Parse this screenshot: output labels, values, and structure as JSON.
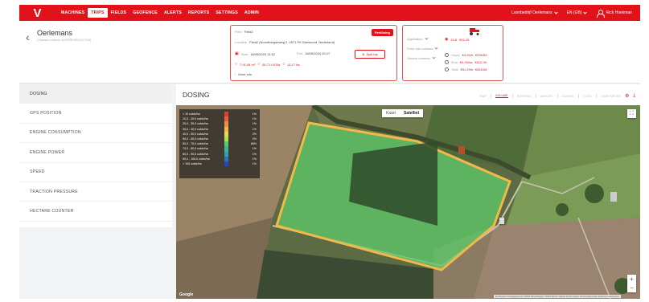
{
  "nav": {
    "logo": "V",
    "items": [
      "MACHINES",
      "TRIPS",
      "FIELDS",
      "GEOFENCE",
      "ALERTS",
      "REPORTS",
      "SETTINGS",
      "ADMIN"
    ],
    "active": "TRIPS",
    "company": "Loonbedrijf Oerlemans",
    "language": "EN (GB)",
    "user": "Rick Hoekman"
  },
  "trip": {
    "title": "Oerlemans",
    "subtitle": "Chassis number: AGFRE0003747105"
  },
  "info_card": {
    "field_label": "Field",
    "field_value": "Field2",
    "status_badge": "Fertilising",
    "location_label": "Location",
    "location_value": "Field2 (Noordbergseweg 2, 4571 PK Driewoord, Nederland)",
    "start_label": "Start",
    "start_value": "18/09/2024 11:12",
    "end_label": "End",
    "end_value": "18/09/2024 20:17",
    "split_button": "Split trip",
    "metric1": "7,91,08 m³",
    "metric2": "60,71 l/100a",
    "metric3": "11,17 ha",
    "more_info": "More info"
  },
  "cost_card": {
    "application_label": "Application",
    "application_value": "20,8",
    "application_value2": "€52,29",
    "price_label": "Price rate contract",
    "service_label": "Service contract",
    "hours_label": "Hours",
    "hours_value": "€4,29/h",
    "hours_total": "€295,83",
    "ha_label": "€/ha",
    "ha_value": "€0,93/ha",
    "ha_total": "€612,39",
    "total_label": "Total",
    "total_value": "€31,29/h",
    "total_total": "€815,66"
  },
  "sidebar": {
    "items": [
      "DOSING",
      "GPS POSITION",
      "ENGINE CONSUMPTION",
      "ENGINE POWER",
      "SPEED",
      "TRACTION PRESSURE",
      "HECTARE COUNTER"
    ],
    "active": "DOSING"
  },
  "main": {
    "title": "DOSING",
    "tabs": [
      "MAP",
      "VOLUME",
      "INTERVAL",
      "AMOUNT",
      "DOSING",
      "TOTAL",
      "USER METER"
    ],
    "active_tab": "VOLUME"
  },
  "map": {
    "map_button": "Kaart",
    "satellite_button": "Satelliet",
    "google_label": "Google",
    "attribution": "Sneltoetsen  Kaartgegevens ©2024 Afbeeldingen ©2024 Airbus, Maxar Technologies  Voorwaarden  Een kaartfout rapporteren",
    "legend": [
      {
        "label": "< 10 cubic/ha",
        "color": "#e23b2e",
        "pct": "1%"
      },
      {
        "label": "10,0 - 20,0 cubic/ha",
        "color": "#e8603a",
        "pct": "1%"
      },
      {
        "label": "20,0 - 30,0 cubic/ha",
        "color": "#ee9042",
        "pct": "1%"
      },
      {
        "label": "30,0 - 40,0 cubic/ha",
        "color": "#f2b94a",
        "pct": "1%"
      },
      {
        "label": "40,0 - 50,0 cubic/ha",
        "color": "#e8d84f",
        "pct": "2%"
      },
      {
        "label": "50,0 - 60,0 cubic/ha",
        "color": "#b6d955",
        "pct": "2%"
      },
      {
        "label": "60,0 - 70,0 cubic/ha",
        "color": "#5fc869",
        "pct": "86%"
      },
      {
        "label": "70,0 - 80,0 cubic/ha",
        "color": "#3bb88e",
        "pct": "1%"
      },
      {
        "label": "80,0 - 90,0 cubic/ha",
        "color": "#2e9fb5",
        "pct": "1%"
      },
      {
        "label": "90,0 - 100,0 cubic/ha",
        "color": "#2e6fc2",
        "pct": "1%"
      },
      {
        "label": "> 100 cubic/ha",
        "color": "#2a46b8",
        "pct": "1%"
      }
    ],
    "colors": {
      "brand": "#e2121b",
      "field_fill": "#5fc869",
      "field_edge": "#f2b94a"
    }
  }
}
